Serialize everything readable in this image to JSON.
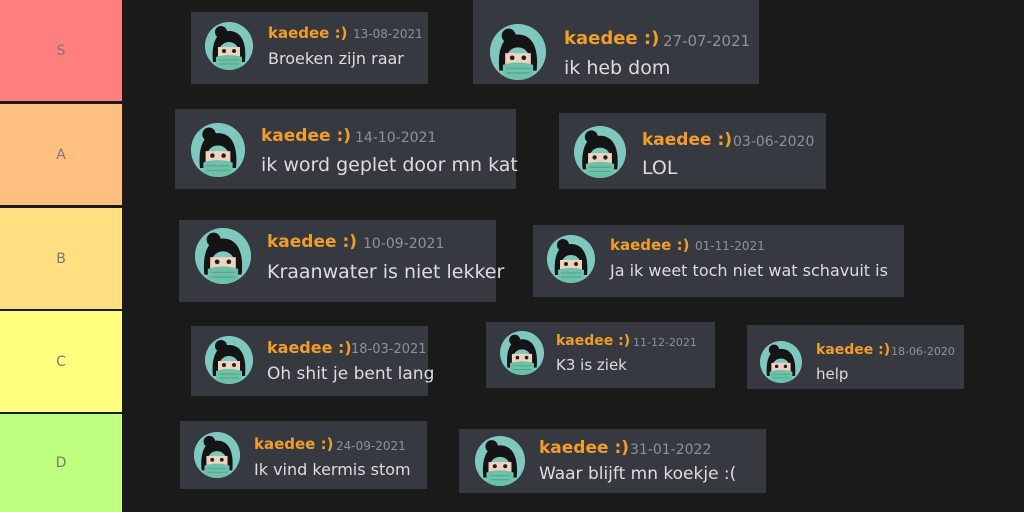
{
  "colors": {
    "S": "#ff7f7f",
    "A": "#ffbf7f",
    "B": "#ffdf7f",
    "C": "#ffff7f",
    "D": "#bfff7f",
    "card": "#36393f",
    "name": "#f29d2b"
  },
  "avatar_icon": "girl-avatar-icon",
  "tiers": [
    {
      "label": "S",
      "messages": [
        {
          "name": "kaedee :)",
          "date": "13-08-2021",
          "text": "Broeken zijn raar"
        },
        {
          "name": "kaedee :)",
          "date": "27-07-2021",
          "text": "ik heb dom"
        }
      ]
    },
    {
      "label": "A",
      "messages": [
        {
          "name": "kaedee :)",
          "date": "14-10-2021",
          "text": "ik word geplet door mn kat"
        },
        {
          "name": "kaedee :)",
          "date": "03-06-2020",
          "text": "LOL"
        }
      ]
    },
    {
      "label": "B",
      "messages": [
        {
          "name": "kaedee :)",
          "date": "10-09-2021",
          "text": "Kraanwater is niet lekker"
        },
        {
          "name": "kaedee :)",
          "date": "01-11-2021",
          "text": "Ja ik weet toch niet wat schavuit is"
        }
      ]
    },
    {
      "label": "C",
      "messages": [
        {
          "name": "kaedee :)",
          "date": "18-03-2021",
          "text": "Oh shit je bent lang"
        },
        {
          "name": "kaedee :)",
          "date": "11-12-2021",
          "text": "K3 is ziek"
        },
        {
          "name": "kaedee :)",
          "date": "18-06-2020",
          "text": "help"
        }
      ]
    },
    {
      "label": "D",
      "messages": [
        {
          "name": "kaedee :)",
          "date": "24-09-2021",
          "text": "Ik vind kermis stom"
        },
        {
          "name": "kaedee :)",
          "date": "31-01-2022",
          "text": "Waar blijft mn koekje :("
        }
      ]
    }
  ]
}
